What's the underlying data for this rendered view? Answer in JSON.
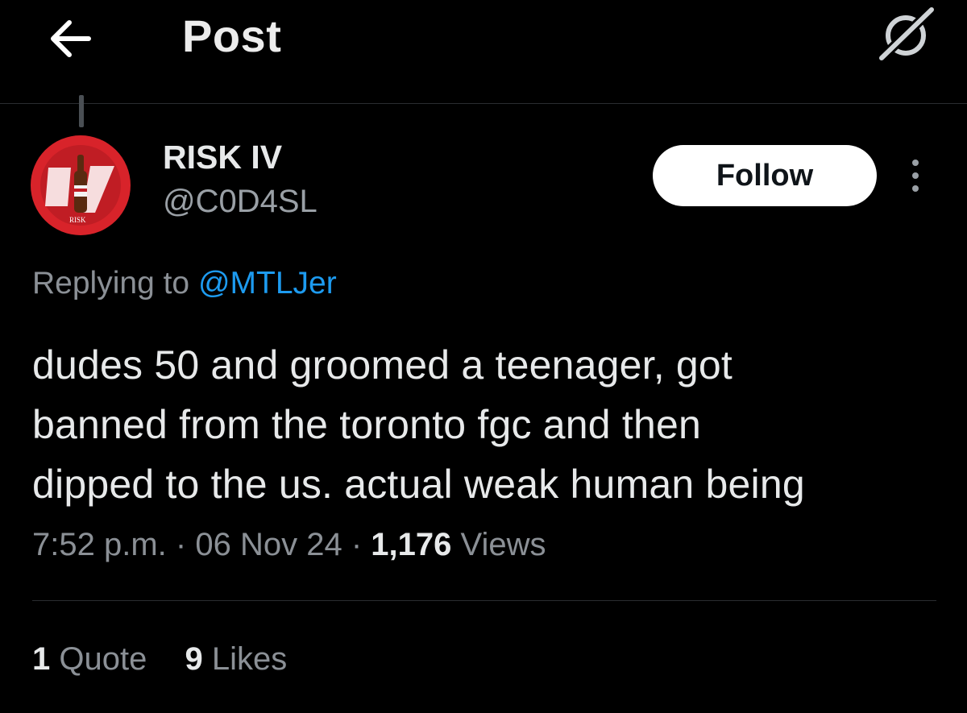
{
  "header": {
    "title": "Post",
    "back_icon": "arrow-left-icon",
    "right_icon": "grok-icon"
  },
  "author": {
    "name": "RISK IV",
    "handle": "@C0D4SL",
    "avatar_text": "RISK",
    "avatar_color": "#d8232a"
  },
  "follow_button": {
    "label": "Follow"
  },
  "more_icon": "more-vertical-icon",
  "reply": {
    "prefix": "Replying to",
    "target": "@MTLJer",
    "link_color": "#1d9bf0"
  },
  "tweet": {
    "lines": [
      "dudes 50 and groomed a teenager, got",
      "banned from the toronto fgc and then",
      "dipped to the us. actual weak human being"
    ]
  },
  "meta": {
    "time": "7:52 p.m.",
    "separator": "·",
    "date": "06 Nov 24",
    "views_count": "1,176",
    "views_label": "Views"
  },
  "stats": {
    "quotes_count": "1",
    "quotes_label": "Quote",
    "likes_count": "9",
    "likes_label": "Likes"
  },
  "colors": {
    "background": "#000000",
    "text_primary": "#e7e9ea",
    "text_secondary": "#8b9096",
    "divider": "#2a2d30"
  }
}
